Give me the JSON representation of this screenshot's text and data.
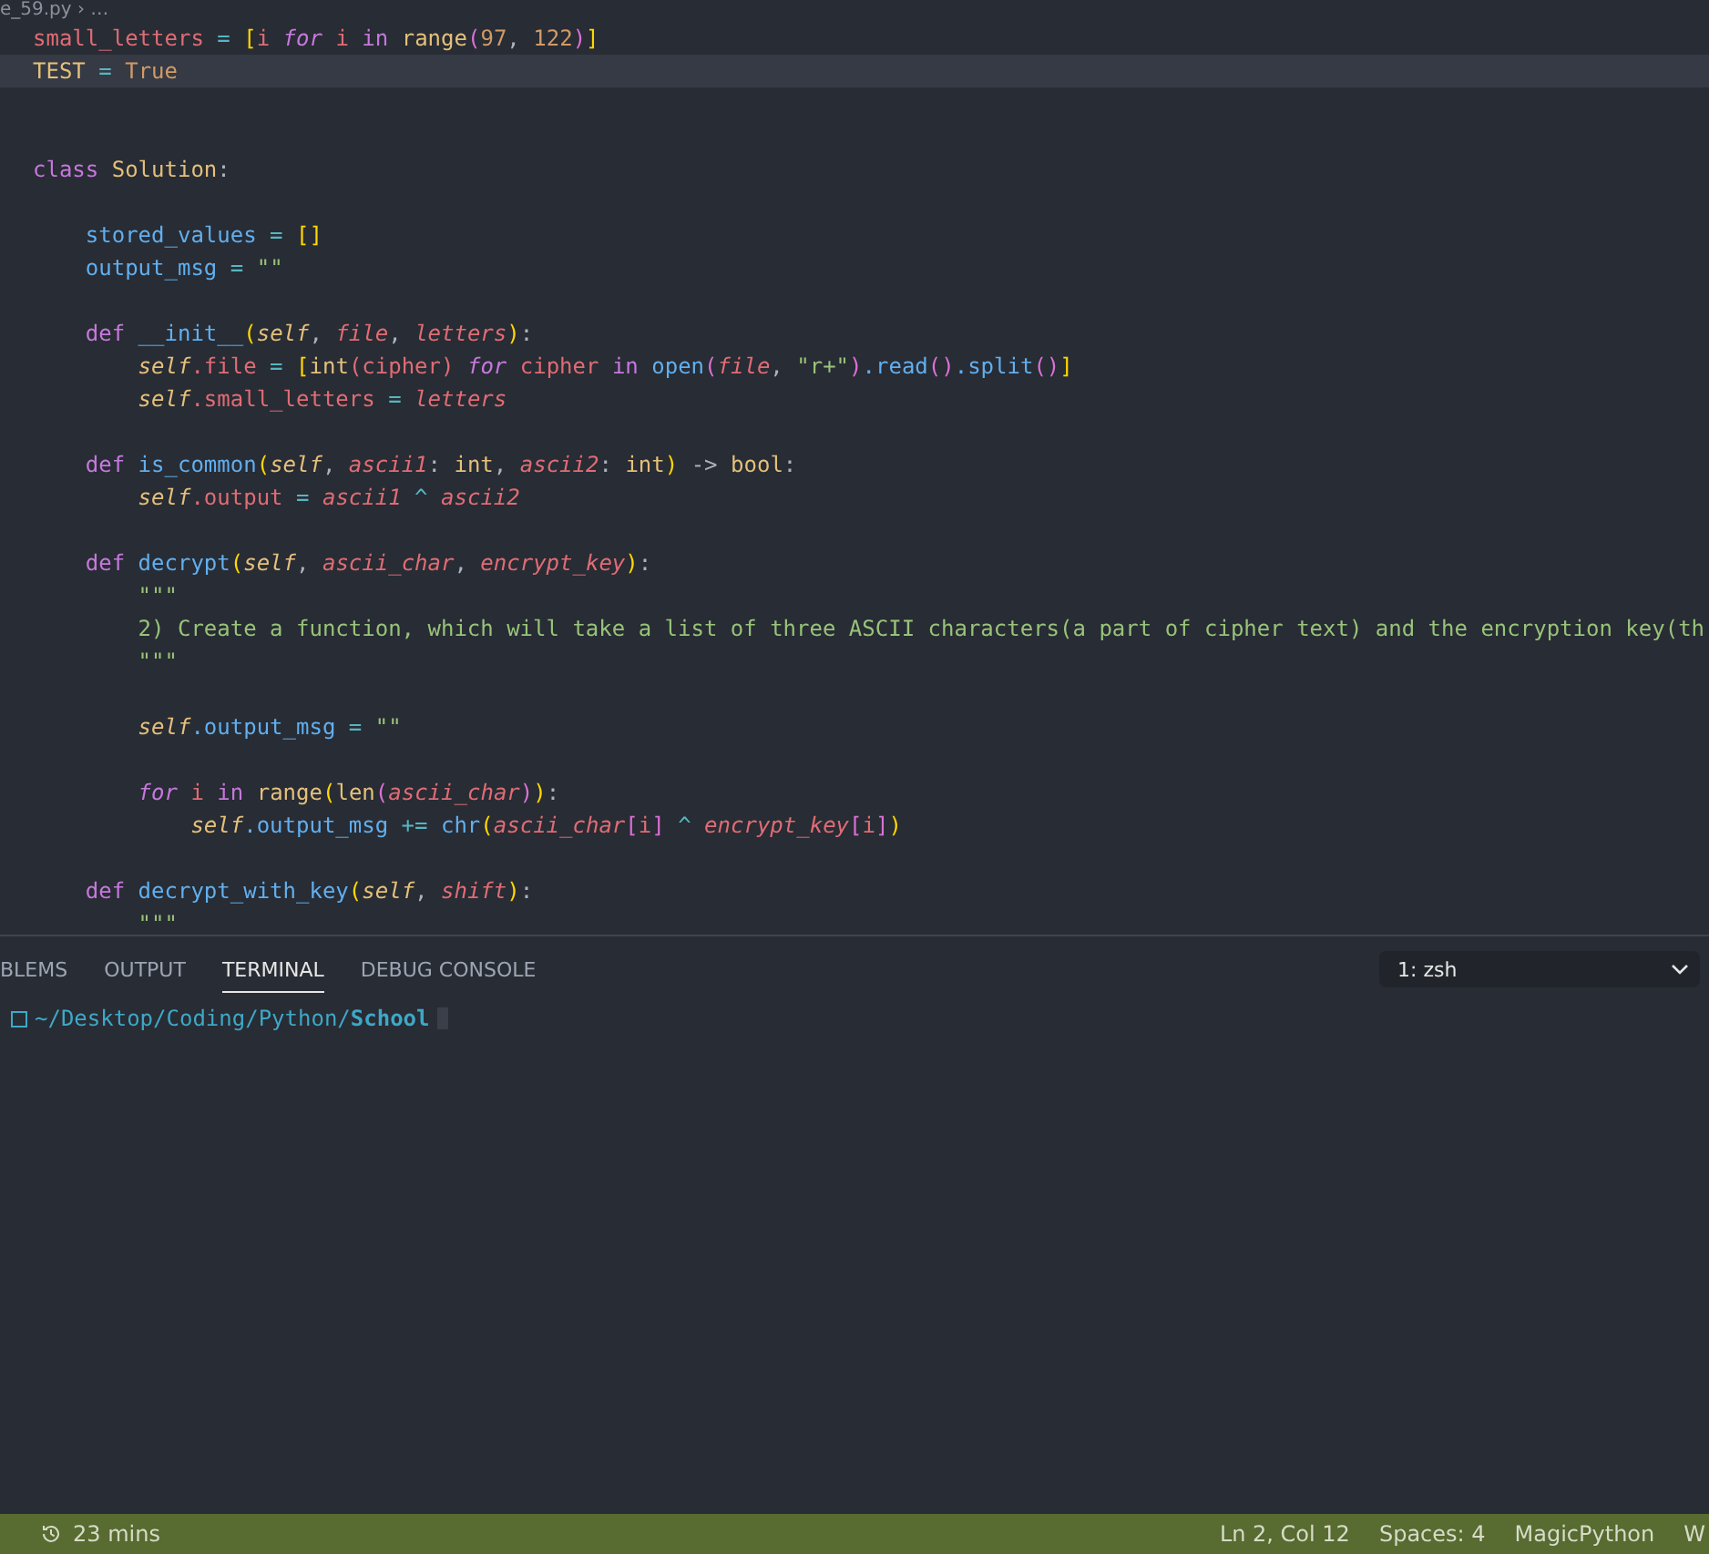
{
  "breadcrumb": "e_59.py › …",
  "editor": {
    "lines": [
      {
        "current": false,
        "tokens": [
          {
            "text": "small_letters",
            "kind": "var"
          },
          {
            "text": " = ",
            "kind": "op"
          },
          {
            "text": "[",
            "kind": "bracket"
          },
          {
            "text": "i ",
            "kind": "var"
          },
          {
            "text": "for",
            "kind": "kwi"
          },
          {
            "text": " i ",
            "kind": "var"
          },
          {
            "text": "in",
            "kind": "kw"
          },
          {
            "text": " range",
            "kind": "builtin"
          },
          {
            "text": "(",
            "kind": "bracket2"
          },
          {
            "text": "97",
            "kind": "num"
          },
          {
            "text": ", ",
            "kind": "punct"
          },
          {
            "text": "122",
            "kind": "num"
          },
          {
            "text": ")",
            "kind": "bracket2"
          },
          {
            "text": "]",
            "kind": "bracket"
          }
        ]
      },
      {
        "current": true,
        "tokens": [
          {
            "text": "TEST",
            "kind": "cls"
          },
          {
            "text": " = ",
            "kind": "op"
          },
          {
            "text": "True",
            "kind": "num"
          }
        ]
      },
      {
        "current": false
      },
      {
        "current": false
      },
      {
        "current": false,
        "tokens": [
          {
            "text": "class",
            "kind": "kw"
          },
          {
            "text": " Solution",
            "kind": "cls"
          },
          {
            "text": ":",
            "kind": "punct"
          }
        ]
      },
      {
        "current": false
      },
      {
        "current": false,
        "tokens": [
          {
            "text": "    stored_values",
            "kind": "fn"
          },
          {
            "text": " = ",
            "kind": "op"
          },
          {
            "text": "[]",
            "kind": "bracket"
          }
        ]
      },
      {
        "current": false,
        "tokens": [
          {
            "text": "    output_msg",
            "kind": "fn"
          },
          {
            "text": " = ",
            "kind": "op"
          },
          {
            "text": "\"\"",
            "kind": "str"
          }
        ]
      },
      {
        "current": false
      },
      {
        "current": false,
        "tokens": [
          {
            "text": "    def",
            "kind": "kw"
          },
          {
            "text": " __init__",
            "kind": "fn"
          },
          {
            "text": "(",
            "kind": "bracket"
          },
          {
            "text": "self",
            "kind": "self"
          },
          {
            "text": ", ",
            "kind": "punct"
          },
          {
            "text": "file",
            "kind": "param"
          },
          {
            "text": ", ",
            "kind": "punct"
          },
          {
            "text": "letters",
            "kind": "param"
          },
          {
            "text": ")",
            "kind": "bracket"
          },
          {
            "text": ":",
            "kind": "punct"
          }
        ]
      },
      {
        "current": false,
        "tokens": [
          {
            "text": "        self",
            "kind": "self"
          },
          {
            "text": ".file",
            "kind": "var"
          },
          {
            "text": " = ",
            "kind": "op"
          },
          {
            "text": "[",
            "kind": "bracket"
          },
          {
            "text": "int",
            "kind": "builtin"
          },
          {
            "text": "(cipher) ",
            "kind": "var"
          },
          {
            "text": "for",
            "kind": "kwi"
          },
          {
            "text": " cipher ",
            "kind": "var"
          },
          {
            "text": "in",
            "kind": "kw"
          },
          {
            "text": " open",
            "kind": "fn"
          },
          {
            "text": "(",
            "kind": "bracket2"
          },
          {
            "text": "file",
            "kind": "param"
          },
          {
            "text": ", ",
            "kind": "punct"
          },
          {
            "text": "\"r+\"",
            "kind": "str"
          },
          {
            "text": ")",
            "kind": "bracket2"
          },
          {
            "text": ".read",
            "kind": "fn"
          },
          {
            "text": "()",
            "kind": "bracket2"
          },
          {
            "text": ".split",
            "kind": "fn"
          },
          {
            "text": "()",
            "kind": "bracket2"
          },
          {
            "text": "]",
            "kind": "bracket"
          }
        ]
      },
      {
        "current": false,
        "tokens": [
          {
            "text": "        self",
            "kind": "self"
          },
          {
            "text": ".small_letters",
            "kind": "var"
          },
          {
            "text": " = ",
            "kind": "op"
          },
          {
            "text": "letters",
            "kind": "param"
          }
        ]
      },
      {
        "current": false
      },
      {
        "current": false,
        "tokens": [
          {
            "text": "    def",
            "kind": "kw"
          },
          {
            "text": " is_common",
            "kind": "fn"
          },
          {
            "text": "(",
            "kind": "bracket"
          },
          {
            "text": "self",
            "kind": "self"
          },
          {
            "text": ", ",
            "kind": "punct"
          },
          {
            "text": "ascii1",
            "kind": "param"
          },
          {
            "text": ": ",
            "kind": "punct"
          },
          {
            "text": "int",
            "kind": "builtin"
          },
          {
            "text": ", ",
            "kind": "punct"
          },
          {
            "text": "ascii2",
            "kind": "param"
          },
          {
            "text": ": ",
            "kind": "punct"
          },
          {
            "text": "int",
            "kind": "builtin"
          },
          {
            "text": ")",
            "kind": "bracket"
          },
          {
            "text": " -> ",
            "kind": "punct"
          },
          {
            "text": "bool",
            "kind": "builtin"
          },
          {
            "text": ":",
            "kind": "punct"
          }
        ]
      },
      {
        "current": false,
        "tokens": [
          {
            "text": "        self",
            "kind": "self"
          },
          {
            "text": ".output",
            "kind": "var"
          },
          {
            "text": " = ",
            "kind": "op"
          },
          {
            "text": "ascii1",
            "kind": "param"
          },
          {
            "text": " ^ ",
            "kind": "op"
          },
          {
            "text": "ascii2",
            "kind": "param"
          }
        ]
      },
      {
        "current": false
      },
      {
        "current": false,
        "tokens": [
          {
            "text": "    def",
            "kind": "kw"
          },
          {
            "text": " decrypt",
            "kind": "fn"
          },
          {
            "text": "(",
            "kind": "bracket"
          },
          {
            "text": "self",
            "kind": "self"
          },
          {
            "text": ", ",
            "kind": "punct"
          },
          {
            "text": "ascii_char",
            "kind": "param"
          },
          {
            "text": ", ",
            "kind": "punct"
          },
          {
            "text": "encrypt_key",
            "kind": "param"
          },
          {
            "text": ")",
            "kind": "bracket"
          },
          {
            "text": ":",
            "kind": "punct"
          }
        ]
      },
      {
        "current": false,
        "tokens": [
          {
            "text": "        \"\"\"",
            "kind": "str"
          }
        ]
      },
      {
        "current": false,
        "tokens": [
          {
            "text": "        2) Create a function, which will take a list of three ASCII characters(a part of cipher text) and the encryption key(th",
            "kind": "str"
          }
        ]
      },
      {
        "current": false,
        "tokens": [
          {
            "text": "        \"\"\"",
            "kind": "str"
          }
        ]
      },
      {
        "current": false
      },
      {
        "current": false,
        "tokens": [
          {
            "text": "        self",
            "kind": "self"
          },
          {
            "text": ".output_msg",
            "kind": "fn"
          },
          {
            "text": " = ",
            "kind": "op"
          },
          {
            "text": "\"\"",
            "kind": "str"
          }
        ]
      },
      {
        "current": false
      },
      {
        "current": false,
        "tokens": [
          {
            "text": "        for",
            "kind": "kwi"
          },
          {
            "text": " i ",
            "kind": "var"
          },
          {
            "text": "in",
            "kind": "kw"
          },
          {
            "text": " range",
            "kind": "builtin"
          },
          {
            "text": "(",
            "kind": "bracket"
          },
          {
            "text": "len",
            "kind": "builtin"
          },
          {
            "text": "(",
            "kind": "bracket2"
          },
          {
            "text": "ascii_char",
            "kind": "param"
          },
          {
            "text": ")",
            "kind": "bracket2"
          },
          {
            "text": ")",
            "kind": "bracket"
          },
          {
            "text": ":",
            "kind": "punct"
          }
        ]
      },
      {
        "current": false,
        "tokens": [
          {
            "text": "            self",
            "kind": "self"
          },
          {
            "text": ".output_msg",
            "kind": "fn"
          },
          {
            "text": " += ",
            "kind": "op"
          },
          {
            "text": "chr",
            "kind": "fn"
          },
          {
            "text": "(",
            "kind": "bracket"
          },
          {
            "text": "ascii_char",
            "kind": "param"
          },
          {
            "text": "[",
            "kind": "bracket2"
          },
          {
            "text": "i",
            "kind": "var"
          },
          {
            "text": "]",
            "kind": "bracket2"
          },
          {
            "text": " ^ ",
            "kind": "op"
          },
          {
            "text": "encrypt_key",
            "kind": "param"
          },
          {
            "text": "[",
            "kind": "bracket2"
          },
          {
            "text": "i",
            "kind": "var"
          },
          {
            "text": "]",
            "kind": "bracket2"
          },
          {
            "text": ")",
            "kind": "bracket"
          }
        ]
      },
      {
        "current": false
      },
      {
        "current": false,
        "tokens": [
          {
            "text": "    def",
            "kind": "kw"
          },
          {
            "text": " decrypt_with_key",
            "kind": "fn"
          },
          {
            "text": "(",
            "kind": "bracket"
          },
          {
            "text": "self",
            "kind": "self"
          },
          {
            "text": ", ",
            "kind": "punct"
          },
          {
            "text": "shift",
            "kind": "param"
          },
          {
            "text": ")",
            "kind": "bracket"
          },
          {
            "text": ":",
            "kind": "punct"
          }
        ]
      },
      {
        "current": false,
        "tokens": [
          {
            "text": "        \"\"\"",
            "kind": "str"
          }
        ]
      }
    ]
  },
  "panel": {
    "tabs": [
      {
        "label": "BLEMS",
        "selected": false
      },
      {
        "label": "OUTPUT",
        "selected": false
      },
      {
        "label": "TERMINAL",
        "selected": true
      },
      {
        "label": "DEBUG CONSOLE",
        "selected": false
      }
    ],
    "terminal_select": "1: zsh",
    "terminal": {
      "path": "~/Desktop/Coding/Python/",
      "folder": "School"
    }
  },
  "status_bar": {
    "time": "23 mins",
    "items": [
      "Ln 2, Col 12",
      "Spaces: 4",
      "MagicPython",
      "W"
    ]
  }
}
